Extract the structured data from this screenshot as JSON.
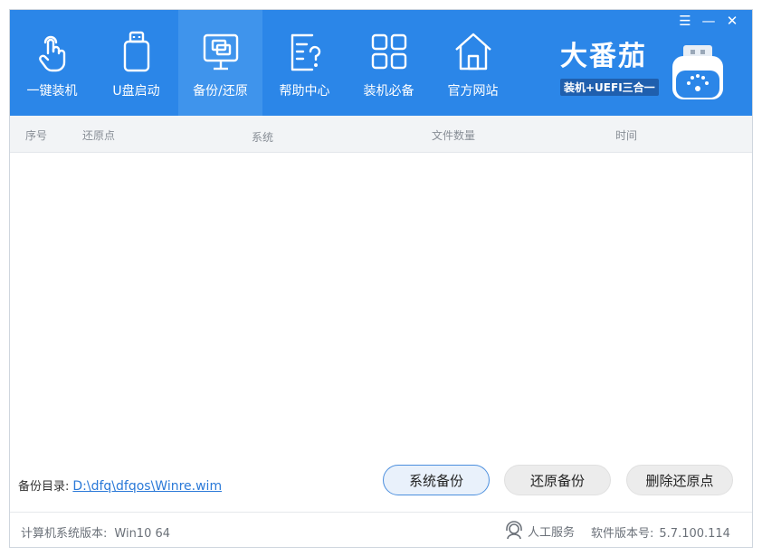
{
  "window_controls": {
    "menu_icon": "menu-icon",
    "minimize_icon": "minimize-icon",
    "close_icon": "close-icon"
  },
  "nav": {
    "items": [
      {
        "label": "一键装机",
        "icon": "touch-hand-icon",
        "active": false
      },
      {
        "label": "U盘启动",
        "icon": "usb-drive-icon",
        "active": false
      },
      {
        "label": "备份/还原",
        "icon": "monitor-copy-icon",
        "active": true
      },
      {
        "label": "帮助中心",
        "icon": "help-document-icon",
        "active": false
      },
      {
        "label": "装机必备",
        "icon": "apps-grid-icon",
        "active": false
      },
      {
        "label": "官方网站",
        "icon": "home-icon",
        "active": false
      }
    ]
  },
  "brand": {
    "name": "大番茄",
    "subtitle": "装机+UEFI三合一"
  },
  "table": {
    "columns": [
      "序号",
      "还原点",
      "系统",
      "文件数量",
      "时间"
    ],
    "rows": []
  },
  "backup_dir": {
    "label": "备份目录:",
    "path": "D:\\dfq\\dfqos\\Winre.wim"
  },
  "buttons": {
    "system_backup": "系统备份",
    "restore_backup": "还原备份",
    "delete_restore_point": "删除还原点"
  },
  "status": {
    "os_label": "计算机系统版本:",
    "os_value": "Win10 64",
    "support_label": "人工服务",
    "version_label": "软件版本号:",
    "version_value": "5.7.100.114"
  },
  "colors": {
    "header_blue": "#2b86e8",
    "active_nav": "#3f94ec",
    "link": "#2a79d8"
  }
}
